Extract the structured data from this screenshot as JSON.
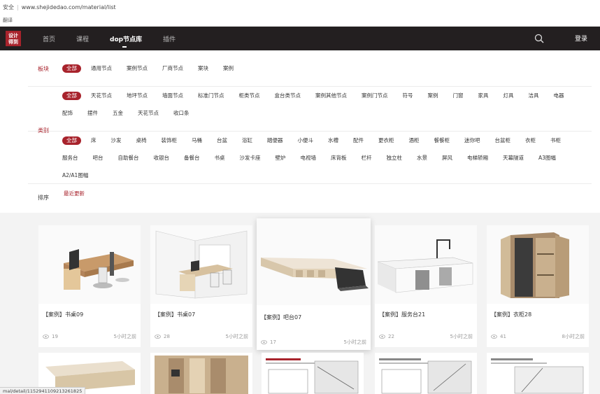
{
  "browser": {
    "secure_label": "安全",
    "url": "www.shejidedao.com/material/list",
    "bookmark": "翻译",
    "status_url": "mal/detail/1152941109213261825"
  },
  "nav": {
    "logo_line1": "设计",
    "logo_line2": "得到",
    "items": [
      "首页",
      "课程",
      "dop节点库",
      "插件"
    ],
    "active": "dop节点库",
    "login": "登录"
  },
  "filters": {
    "sections": [
      {
        "label": "板块",
        "options": [
          "全部",
          "通用节点",
          "案例节点",
          "厂商节点",
          "案块",
          "案例"
        ]
      },
      {
        "label": "类别",
        "options": [
          "全部",
          "天花节点",
          "地坪节点",
          "墙面节点",
          "标准门节点",
          "柜类节点",
          "盒台类节点",
          "案例其他节点",
          "案例门节点",
          "符号",
          "案例",
          "门窗",
          "家具",
          "灯具",
          "洁具",
          "电器",
          "配饰",
          "摆件",
          "五金",
          "天花节点",
          "收口条"
        ]
      },
      {
        "label": "对象",
        "options": [
          "全部",
          "床",
          "沙发",
          "桌椅",
          "装饰柜",
          "马桶",
          "台盆",
          "浴缸",
          "踏便器",
          "小便斗",
          "水槽",
          "配件",
          "更衣柜",
          "酒柜",
          "餐餐柜",
          "迷你吧",
          "台盆柜",
          "衣柜",
          "书柜",
          "服务台",
          "吧台",
          "自助餐台",
          "收银台",
          "备餐台",
          "书桌",
          "沙发卡座",
          "壁炉",
          "电视墙",
          "床背板",
          "栏杆",
          "独立柱",
          "水景",
          "屏风",
          "电梯轿厢",
          "天幕隧道",
          "A3图幅",
          "A2/A1图幅"
        ]
      },
      {
        "label": "排序",
        "options": [
          "最近更新"
        ]
      }
    ]
  },
  "cards": [
    {
      "title": "【案例】书桌09",
      "views": "19",
      "time": "5小时之前"
    },
    {
      "title": "【案例】书桌07",
      "views": "28",
      "time": "5小时之前"
    },
    {
      "title": "【案例】吧台07",
      "views": "17",
      "time": "5小时之前"
    },
    {
      "title": "【案例】服务台21",
      "views": "22",
      "time": "5小时之前"
    },
    {
      "title": "【案例】衣柜28",
      "views": "41",
      "time": "8小时之前"
    }
  ],
  "colors": {
    "brand": "#a8232c",
    "nav_bg": "#231f20"
  }
}
